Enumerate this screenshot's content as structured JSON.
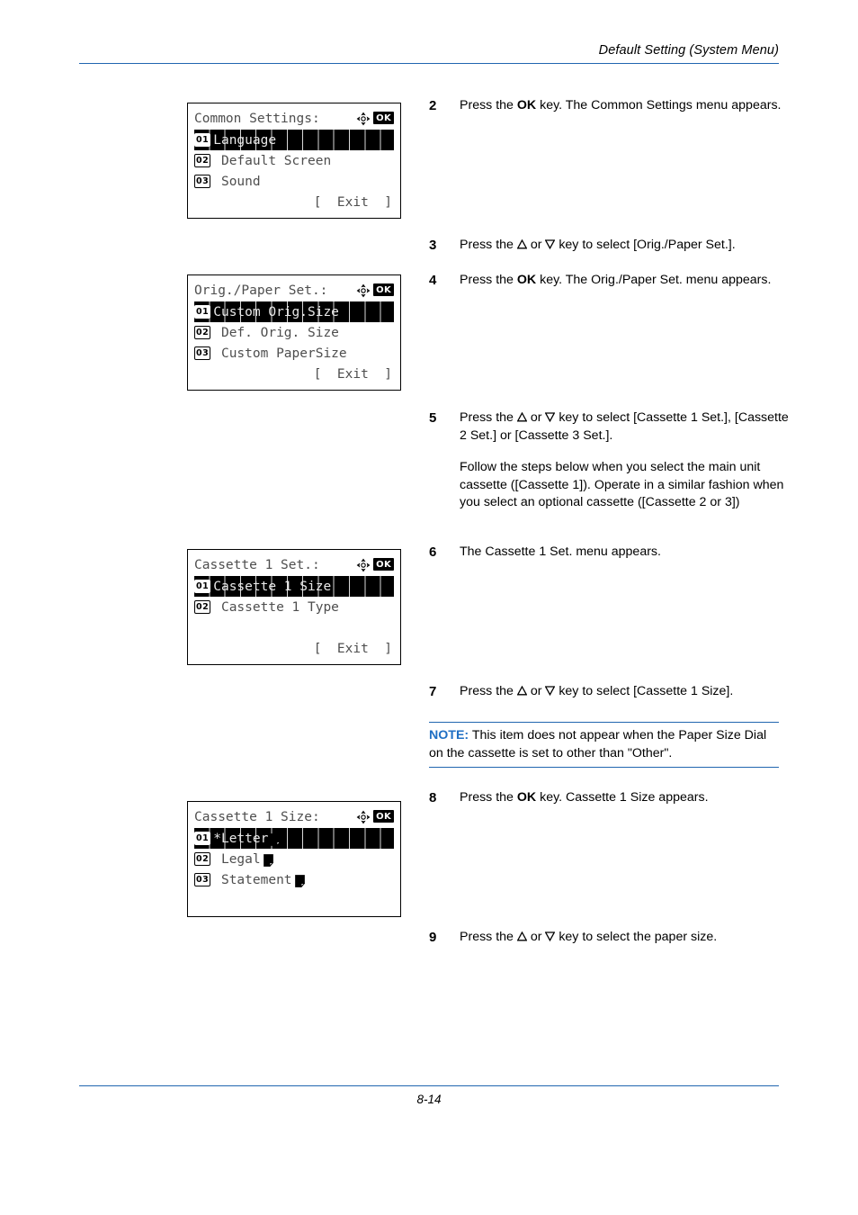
{
  "header": {
    "title": "Default Setting (System Menu)"
  },
  "footer": {
    "page_number": "8-14"
  },
  "colors": {
    "rule_blue": "#2166b0",
    "note_blue": "#1f6fc4",
    "lcd_text": "#4e4e4e",
    "lcd_highlight_bg": "#000000"
  },
  "panels": [
    {
      "title": "Common Settings:",
      "ok_badge": "OK",
      "rows": [
        {
          "badge": "01",
          "label": "Language",
          "selected": true,
          "gap": "",
          "icon": ""
        },
        {
          "badge": "02",
          "label": "Default Screen",
          "selected": false,
          "gap": " ",
          "icon": ""
        },
        {
          "badge": "03",
          "label": "Sound",
          "selected": false,
          "gap": " ",
          "icon": ""
        }
      ],
      "exit": "[  Exit  ]",
      "blank_rows": 0
    },
    {
      "title": "Orig./Paper Set.:",
      "ok_badge": "OK",
      "rows": [
        {
          "badge": "01",
          "label": "Custom Orig.Size",
          "selected": true,
          "gap": "",
          "icon": ""
        },
        {
          "badge": "02",
          "label": "Def. Orig. Size",
          "selected": false,
          "gap": " ",
          "icon": ""
        },
        {
          "badge": "03",
          "label": "Custom PaperSize",
          "selected": false,
          "gap": " ",
          "icon": ""
        }
      ],
      "exit": "[  Exit  ]",
      "blank_rows": 0
    },
    {
      "title": "Cassette 1 Set.:",
      "ok_badge": "OK",
      "rows": [
        {
          "badge": "01",
          "label": "Cassette 1 Size",
          "selected": true,
          "gap": "",
          "icon": ""
        },
        {
          "badge": "02",
          "label": "Cassette 1 Type",
          "selected": false,
          "gap": " ",
          "icon": ""
        }
      ],
      "exit": "[  Exit  ]",
      "blank_rows": 1
    },
    {
      "title": "Cassette 1 Size:",
      "ok_badge": "OK",
      "rows": [
        {
          "badge": "01",
          "label": "*Letter",
          "selected": true,
          "gap": "",
          "icon": "paper-portrait-icon"
        },
        {
          "badge": "02",
          "label": "Legal",
          "selected": false,
          "gap": " ",
          "icon": "paper-portrait-icon"
        },
        {
          "badge": "03",
          "label": "Statement",
          "selected": false,
          "gap": " ",
          "icon": "paper-portrait-icon"
        }
      ],
      "exit": "",
      "blank_rows": 1
    }
  ],
  "steps": [
    {
      "number": "2",
      "parts": [
        [
          {
            "t": "Press the "
          },
          {
            "t": "OK",
            "bold": true
          },
          {
            "t": " key. The Common Settings menu appears."
          }
        ]
      ]
    },
    {
      "number": "3",
      "parts": [
        [
          {
            "t": "Press the "
          },
          {
            "icon": "triangle-up-icon"
          },
          {
            "t": " or "
          },
          {
            "icon": "triangle-down-icon"
          },
          {
            "t": " key to select [Orig./Paper Set.]."
          }
        ]
      ]
    },
    {
      "number": "4",
      "parts": [
        [
          {
            "t": "Press the "
          },
          {
            "t": "OK",
            "bold": true
          },
          {
            "t": " key. The Orig./Paper Set. menu appears."
          }
        ]
      ]
    },
    {
      "number": "5",
      "parts": [
        [
          {
            "t": "Press the "
          },
          {
            "icon": "triangle-up-icon"
          },
          {
            "t": " or "
          },
          {
            "icon": "triangle-down-icon"
          },
          {
            "t": " key to select [Cassette 1 Set.], [Cassette 2 Set.] or [Cassette 3 Set.]."
          }
        ],
        [
          {
            "t": "Follow the steps below when you select the main unit cassette ([Cassette 1]). Operate in a similar fashion when you select an optional cassette ([Cassette 2 or 3])"
          }
        ]
      ]
    },
    {
      "number": "6",
      "parts": [
        [
          {
            "t": "The Cassette 1 Set. menu appears."
          }
        ]
      ]
    },
    {
      "number": "7",
      "parts": [
        [
          {
            "t": "Press the "
          },
          {
            "icon": "triangle-up-icon"
          },
          {
            "t": " or "
          },
          {
            "icon": "triangle-down-icon"
          },
          {
            "t": " key to select [Cassette 1 Size]."
          }
        ]
      ]
    },
    {
      "number": "8",
      "parts": [
        [
          {
            "t": "Press the "
          },
          {
            "t": "OK",
            "bold": true
          },
          {
            "t": " key. Cassette 1 Size appears."
          }
        ]
      ]
    },
    {
      "number": "9",
      "parts": [
        [
          {
            "t": "Press the "
          },
          {
            "icon": "triangle-up-icon"
          },
          {
            "t": " or "
          },
          {
            "icon": "triangle-down-icon"
          },
          {
            "t": " key to select the paper size."
          }
        ]
      ]
    }
  ],
  "note": {
    "label": "NOTE:",
    "text": " This item does not appear when the Paper Size Dial on the cassette is set to other than \"Other\"."
  },
  "layout": {
    "panel_tops": [
      114,
      305,
      610,
      890
    ],
    "step_tops": [
      108,
      263,
      302,
      455,
      604,
      759,
      877,
      1032
    ]
  }
}
